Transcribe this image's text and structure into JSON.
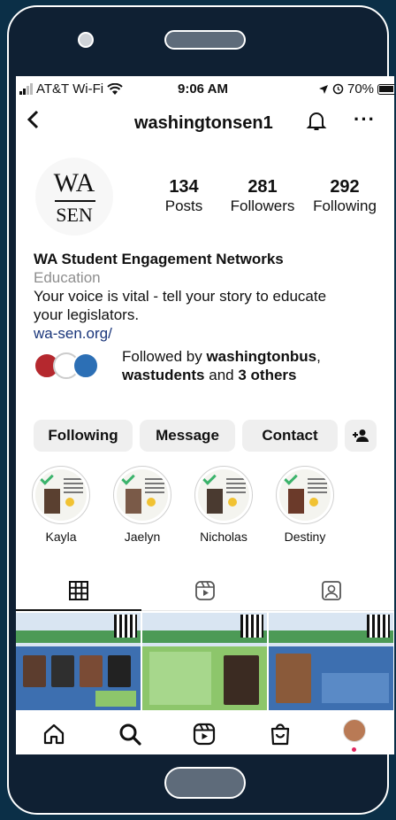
{
  "status": {
    "carrier": "AT&T Wi-Fi",
    "time": "9:06 AM",
    "battery_text": "70%"
  },
  "header": {
    "username": "washingtonsen1",
    "back_icon": "back-chevron-icon",
    "notify_icon": "bell-icon",
    "more_icon": "more-icon"
  },
  "profile": {
    "logo_top": "WA",
    "logo_bottom": "SEN",
    "stats": [
      {
        "value": "134",
        "label": "Posts"
      },
      {
        "value": "281",
        "label": "Followers"
      },
      {
        "value": "292",
        "label": "Following"
      }
    ],
    "name": "WA Student Engagement Networks",
    "category": "Education",
    "bio_line1": "Your voice is vital - tell your story to educate",
    "bio_line2": "your legislators.",
    "link": "wa-sen.org/"
  },
  "followed_by": {
    "prefix": "Followed by ",
    "user1": "washingtonbus",
    "sep": ",",
    "user2": "wastudents",
    "mid": " and ",
    "others": "3 others"
  },
  "actions": {
    "following": "Following",
    "message": "Message",
    "contact": "Contact"
  },
  "highlights": [
    {
      "label": "Kayla"
    },
    {
      "label": "Jaelyn"
    },
    {
      "label": "Nicholas"
    },
    {
      "label": "Destiny"
    }
  ],
  "colors": {
    "background": "#0b2f47",
    "link": "#19357a",
    "button_bg": "#efefef",
    "notification_dot": "#e0245e"
  }
}
